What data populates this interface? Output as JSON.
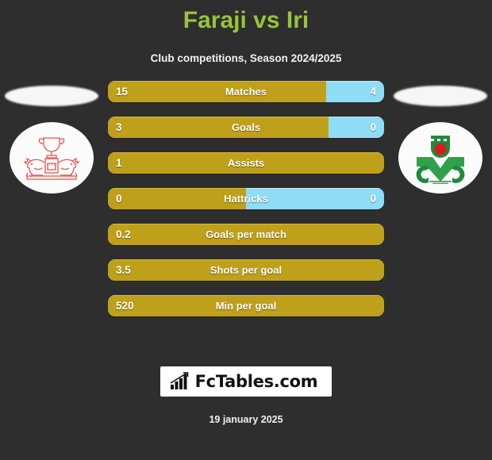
{
  "header": {
    "title": "Faraji vs Iri",
    "subtitle": "Club competitions, Season 2024/2025",
    "title_color": "#9ac23c"
  },
  "teams": {
    "home": {
      "name": "Faraji",
      "badge_icon": "trophy-lions-crest-icon",
      "badge_color": "#e84a4a"
    },
    "away": {
      "name": "Iri",
      "badge_icon": "green-shield-crest-icon",
      "badge_color": "#1a9641"
    }
  },
  "colors": {
    "home_bar": "#bfa01a",
    "away_bar": "#8fdcf7",
    "background": "#2e2e2e"
  },
  "chart_data": {
    "type": "bar",
    "title": "Faraji vs Iri",
    "subtitle": "Club competitions, Season 2024/2025",
    "orientation": "horizontal-diverging",
    "categories": [
      "Matches",
      "Goals",
      "Assists",
      "Hattricks",
      "Goals per match",
      "Shots per goal",
      "Min per goal"
    ],
    "series": [
      {
        "name": "Faraji",
        "values": [
          "15",
          "3",
          "1",
          "0",
          "0.2",
          "3.5",
          "520"
        ]
      },
      {
        "name": "Iri",
        "values": [
          "4",
          "0",
          null,
          "0",
          null,
          null,
          null
        ]
      }
    ],
    "home_fill_pct": [
      79,
      80,
      100,
      50,
      100,
      100,
      100
    ],
    "legend": "position: badges left and right"
  },
  "stats": [
    {
      "label": "Matches",
      "home": "15",
      "away": "4",
      "home_pct": 79
    },
    {
      "label": "Goals",
      "home": "3",
      "away": "0",
      "home_pct": 80
    },
    {
      "label": "Assists",
      "home": "1",
      "away": null,
      "home_pct": 100
    },
    {
      "label": "Hattricks",
      "home": "0",
      "away": "0",
      "home_pct": 50
    },
    {
      "label": "Goals per match",
      "home": "0.2",
      "away": null,
      "home_pct": 100
    },
    {
      "label": "Shots per goal",
      "home": "3.5",
      "away": null,
      "home_pct": 100
    },
    {
      "label": "Min per goal",
      "home": "520",
      "away": null,
      "home_pct": 100
    }
  ],
  "footer": {
    "brand": "FcTables.com",
    "brand_icon": "bar-chart-growth-icon",
    "date": "19 january 2025"
  }
}
